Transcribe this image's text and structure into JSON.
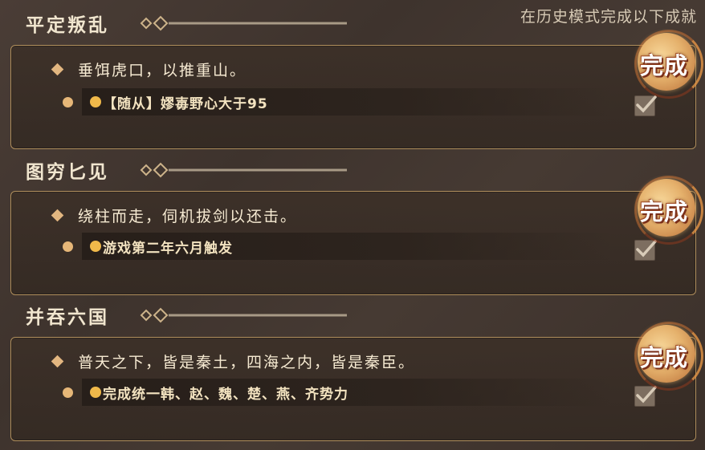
{
  "header": {
    "hint": "在历史模式完成以下成就"
  },
  "achievements": [
    {
      "title": "平定叛乱",
      "goal": "垂饵虎口，以推重山。",
      "condition": "【随从】嫪毐野心大于95",
      "status": "完成",
      "checked": true
    },
    {
      "title": "图穷匕见",
      "goal": "绕柱而走，伺机拔剑以还击。",
      "condition": "游戏第二年六月触发",
      "status": "完成",
      "checked": true
    },
    {
      "title": "并吞六国",
      "goal": "普天之下，皆是秦土，四海之内，皆是秦臣。",
      "condition": "完成统一韩、赵、魏、楚、燕、齐势力",
      "status": "完成",
      "checked": true
    }
  ],
  "colors": {
    "accent_gold": "#e2b680",
    "panel_border": "#b08f5d",
    "seal_red": "#a4622c"
  },
  "icons": {
    "ornament": "title-ornament-icon",
    "diamond": "diamond-bullet-icon",
    "check": "checkmark-icon"
  }
}
